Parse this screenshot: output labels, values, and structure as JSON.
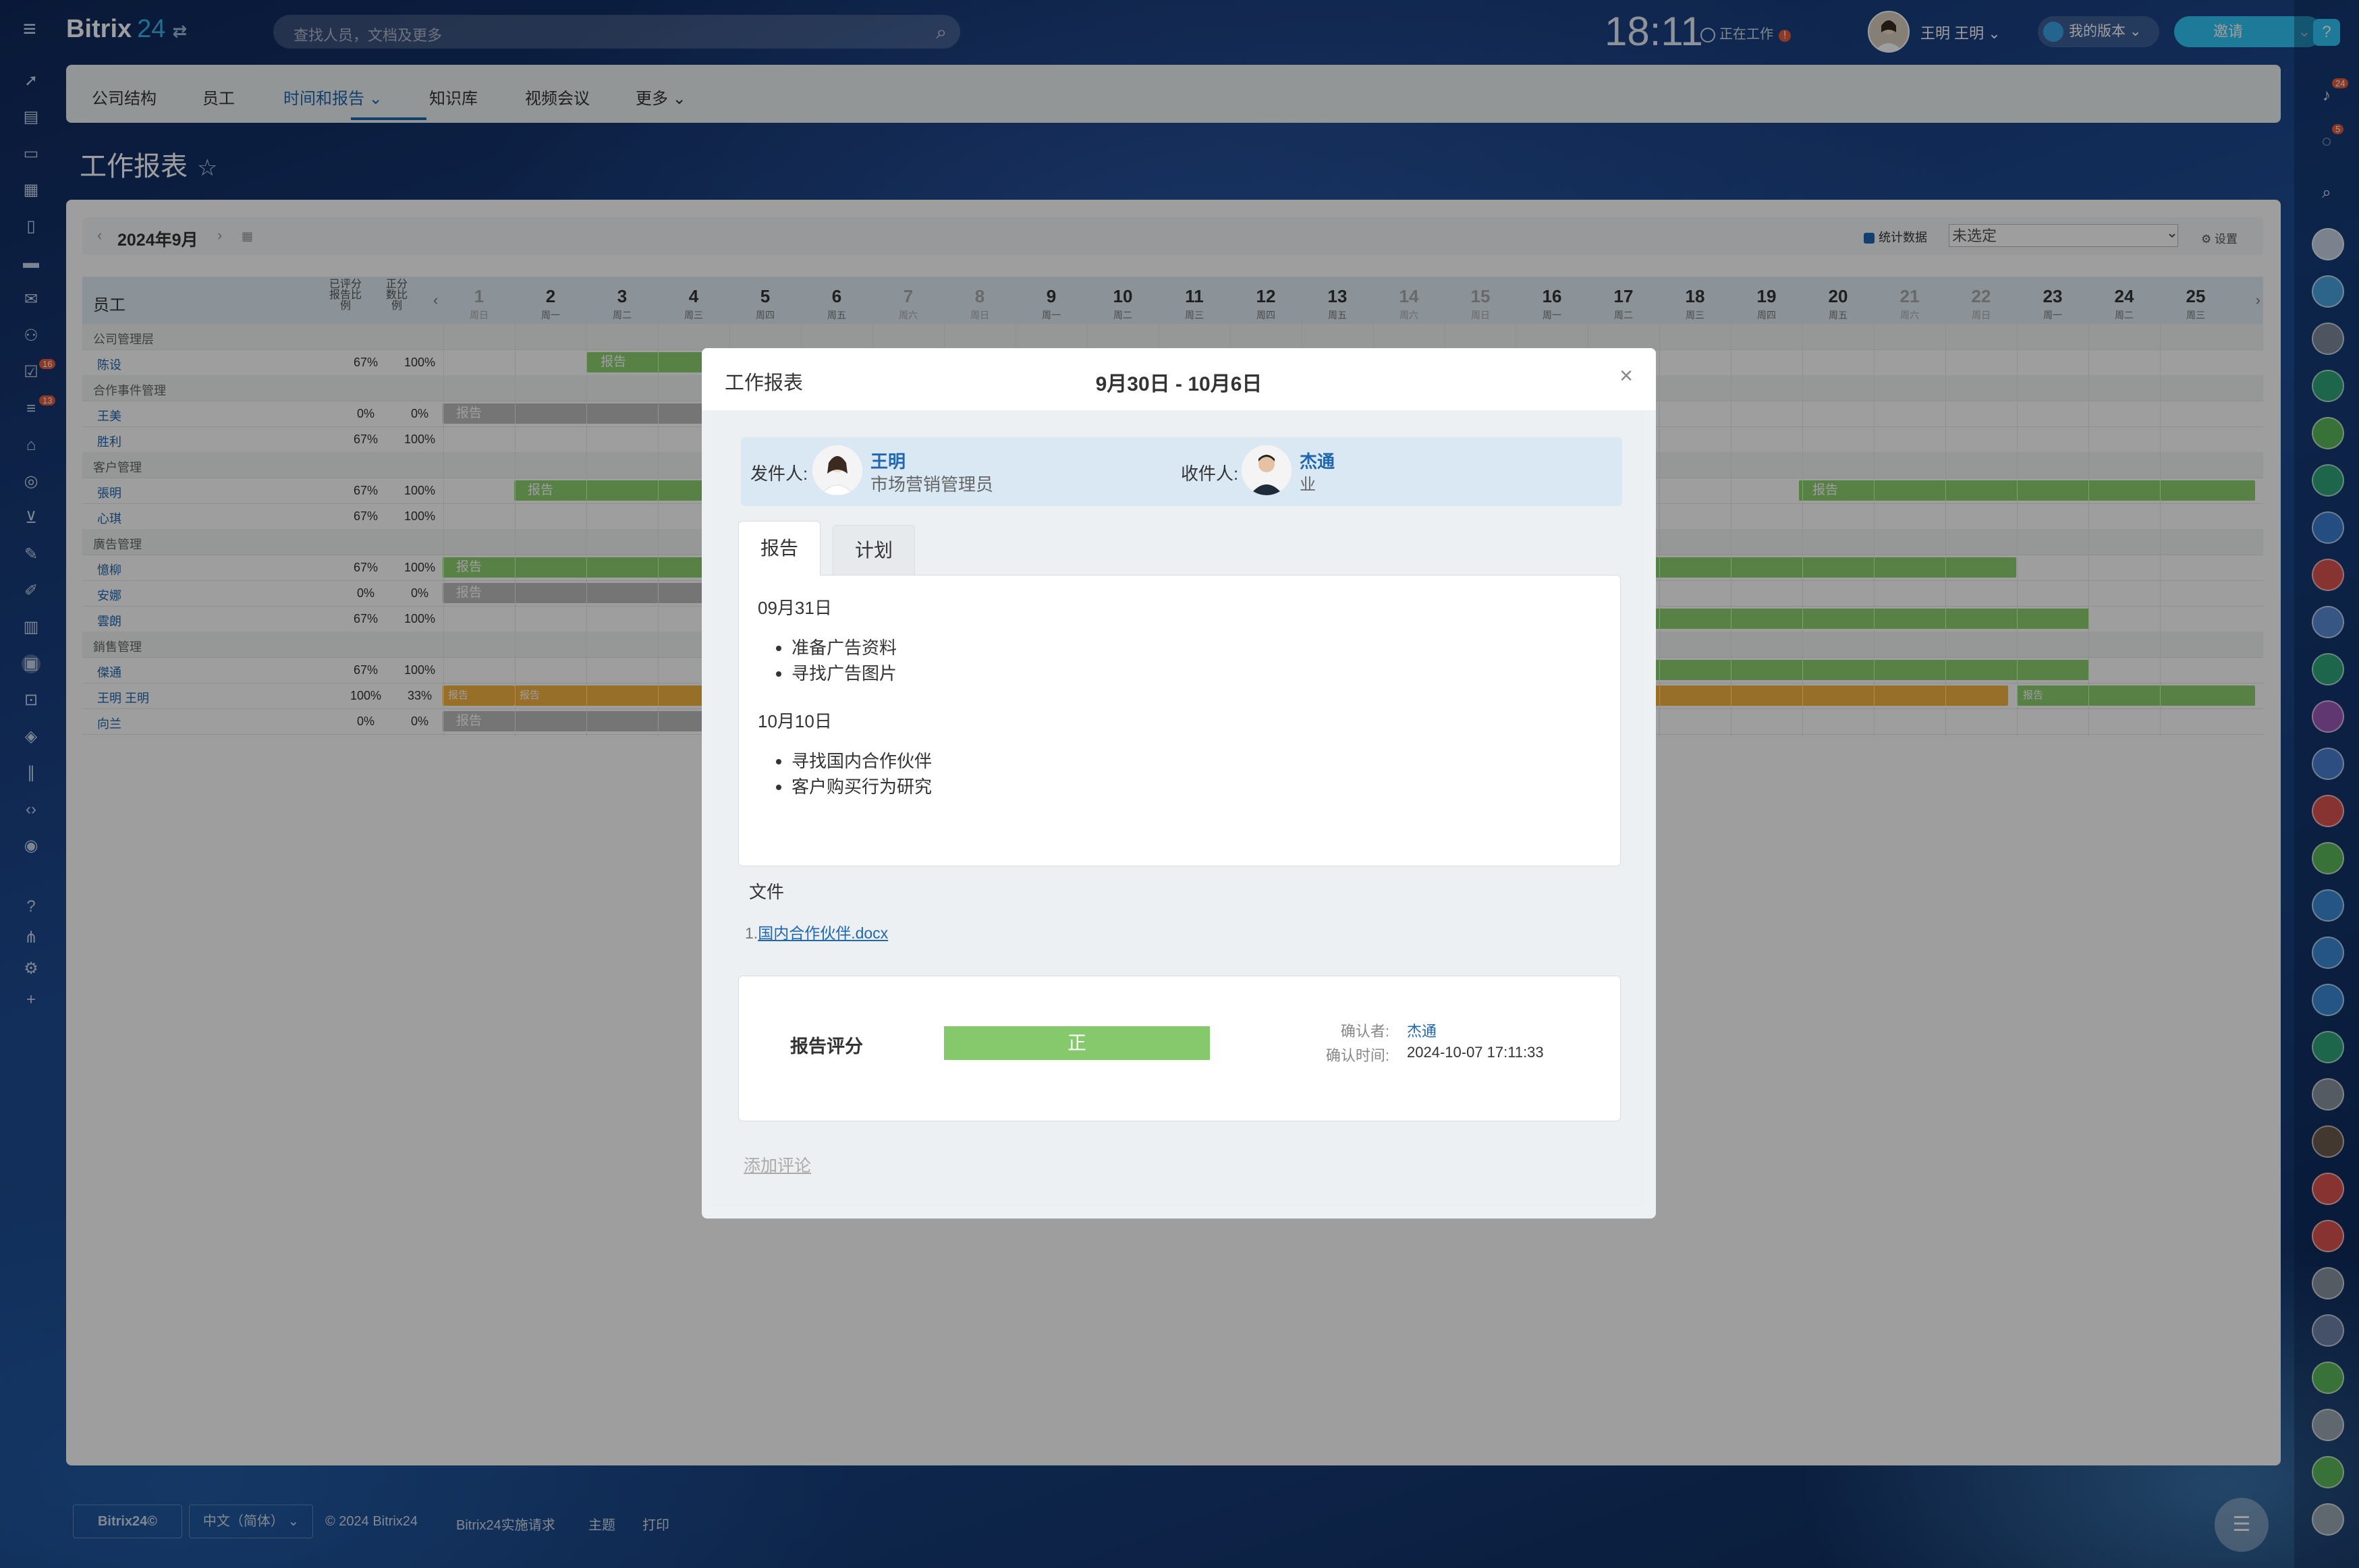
{
  "app": {
    "logo_text": "Bitrix",
    "logo_number": "24",
    "logo_switch": "⇄"
  },
  "search": {
    "placeholder": "查找人员，文档及更多"
  },
  "clock": {
    "time": "18:11",
    "status_label": "正在工作",
    "status_badge": "!"
  },
  "user": {
    "name": "王明 王明 ⌄"
  },
  "version_button": {
    "label": "我的版本 ⌄"
  },
  "invite_button": {
    "label": "邀请",
    "caret": "⌄"
  },
  "left_sidebar": {
    "badge_tasks": "16",
    "badge_feed": "13"
  },
  "right_sidebar": {
    "badge_notifications": "24",
    "badge_chat": "5"
  },
  "nav": {
    "tabs": [
      {
        "label": "公司结构"
      },
      {
        "label": "员工"
      },
      {
        "label": "时间和报告 ⌄"
      },
      {
        "label": "知识库"
      },
      {
        "label": "视频会议"
      },
      {
        "label": "更多 ⌄"
      }
    ]
  },
  "page": {
    "title": "工作报表",
    "star": "☆"
  },
  "toolbar": {
    "month": "2024年9月",
    "prev": "‹",
    "next": "›",
    "stats_label": "统计数据",
    "select_value": "未选定",
    "settings_label": "设置"
  },
  "table": {
    "col_employee": "员工",
    "col_rated": "已评分报告比例",
    "col_positive": "正分数比例",
    "days": [
      {
        "d": "1",
        "w": "周日",
        "we": true
      },
      {
        "d": "2",
        "w": "周一",
        "we": false
      },
      {
        "d": "3",
        "w": "周二",
        "we": false
      },
      {
        "d": "4",
        "w": "周三",
        "we": false
      },
      {
        "d": "5",
        "w": "周四",
        "we": false
      },
      {
        "d": "6",
        "w": "周五",
        "we": false
      },
      {
        "d": "7",
        "w": "周六",
        "we": true
      },
      {
        "d": "8",
        "w": "周日",
        "we": true
      },
      {
        "d": "9",
        "w": "周一",
        "we": false
      },
      {
        "d": "10",
        "w": "周二",
        "we": false
      },
      {
        "d": "11",
        "w": "周三",
        "we": false
      },
      {
        "d": "12",
        "w": "周四",
        "we": false
      },
      {
        "d": "13",
        "w": "周五",
        "we": false
      },
      {
        "d": "14",
        "w": "周六",
        "we": true
      },
      {
        "d": "15",
        "w": "周日",
        "we": true
      },
      {
        "d": "16",
        "w": "周一",
        "we": false
      },
      {
        "d": "17",
        "w": "周二",
        "we": false
      },
      {
        "d": "18",
        "w": "周三",
        "we": false
      },
      {
        "d": "19",
        "w": "周四",
        "we": false
      },
      {
        "d": "20",
        "w": "周五",
        "we": false
      },
      {
        "d": "21",
        "w": "周六",
        "we": true
      },
      {
        "d": "22",
        "w": "周日",
        "we": true
      },
      {
        "d": "23",
        "w": "周一",
        "we": false
      },
      {
        "d": "24",
        "w": "周二",
        "we": false
      },
      {
        "d": "25",
        "w": "周三",
        "we": false
      }
    ],
    "groups": {
      "g1": "公司管理层",
      "g2": "合作事件管理",
      "g3": "客户管理",
      "g4": "廣告管理",
      "g5": "銷售管理"
    },
    "rows": {
      "r1": {
        "name": "陈设",
        "rated": "67%",
        "pos": "100%"
      },
      "r2": {
        "name": "王美",
        "rated": "0%",
        "pos": "0%"
      },
      "r3": {
        "name": "胜利",
        "rated": "67%",
        "pos": "100%"
      },
      "r4": {
        "name": "張明",
        "rated": "67%",
        "pos": "100%"
      },
      "r5": {
        "name": "心琪",
        "rated": "67%",
        "pos": "100%"
      },
      "r6": {
        "name": "憶柳",
        "rated": "67%",
        "pos": "100%"
      },
      "r7": {
        "name": "安娜",
        "rated": "0%",
        "pos": "0%"
      },
      "r8": {
        "name": "雲朗",
        "rated": "67%",
        "pos": "100%"
      },
      "r9": {
        "name": "傑通",
        "rated": "67%",
        "pos": "100%"
      },
      "r10": {
        "name": "王明 王明",
        "rated": "100%",
        "pos": "33%"
      },
      "r11": {
        "name": "向兰",
        "rated": "0%",
        "pos": "0%"
      }
    },
    "report_label": "报告"
  },
  "footer": {
    "brand": "Bitrix24©",
    "language": "中文（简体） ⌄",
    "copyright": "© 2024 Bitrix24",
    "impl": "Bitrix24实施请求",
    "theme": "主题",
    "print": "打印"
  },
  "modal": {
    "title": "工作报表",
    "range": "9月30日 - 10月6日",
    "close": "×",
    "sender_label": "发件人:",
    "sender_name": "王明",
    "sender_position": "市场营销管理员",
    "receiver_label": "收件人:",
    "receiver_name": "杰通",
    "receiver_position": "业",
    "tab_report": "报告",
    "tab_plan": "计划",
    "entries": [
      {
        "date": "09月31日",
        "items": [
          "准备广告资料",
          "寻找广告图片"
        ]
      },
      {
        "date": "10月10日",
        "items": [
          "寻找国内合作伙伴",
          "客户购买行为研究"
        ]
      }
    ],
    "files_label": "文件",
    "file_index": "1.",
    "file_name": "国内合作伙伴.docx",
    "rating_label": "报告评分",
    "rating_value": "正",
    "confirmed_by_label": "确认者:",
    "confirmed_by": "杰通",
    "confirmed_time_label": "确认时间:",
    "confirmed_time": "2024-10-07 17:11:33",
    "add_comment": "添加评论"
  },
  "colors": {
    "accent": "#2067b0",
    "positive": "#86c96c",
    "neutral": "#bdbdbd",
    "orange": "#f5b342",
    "invite": "#2fc6f6"
  }
}
